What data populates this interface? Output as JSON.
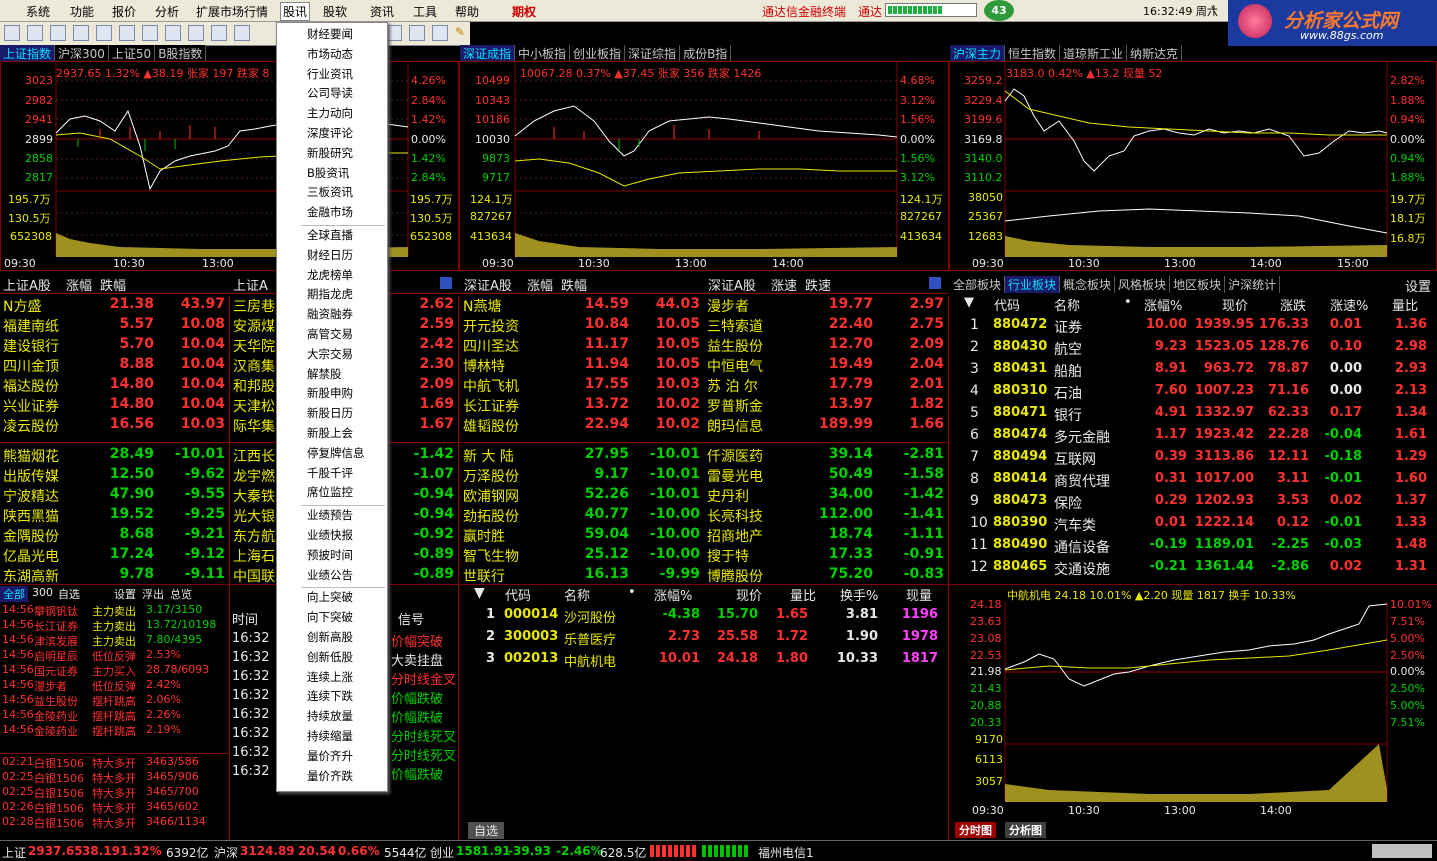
{
  "menu": {
    "items": [
      "系统",
      "功能",
      "报价",
      "分析",
      "扩展市场行情",
      "股讯",
      "股软",
      "资讯",
      "工具",
      "帮助",
      "期权"
    ],
    "promo1": "通达信金融终端",
    "promo2": "通达",
    "badge": "43",
    "clock": "16:32:49 周六",
    "logo": "分析家公式网",
    "logo_url": "www.88gs.com"
  },
  "dropdown": [
    "财经要闻",
    "市场动态",
    "行业资讯",
    "公司导读",
    "主力动向",
    "深度评论",
    "新股研究",
    "B股资讯",
    "三板资讯",
    "金融市场",
    "全球直播",
    "财经日历",
    "龙虎榜单",
    "期指龙虎",
    "融资融券",
    "高管交易",
    "大宗交易",
    "解禁股",
    "新股申购",
    "新股日历",
    "新股上会",
    "停复牌信息",
    "千股千评",
    "席位监控",
    "业绩预告",
    "业绩快报",
    "预披时间",
    "业绩公告",
    "向上突破",
    "向下突破",
    "创新高股",
    "创新低股",
    "连续上涨",
    "连续下跌",
    "持续放量",
    "持续缩量",
    "量价齐升",
    "量价齐跌"
  ],
  "chart1": {
    "tabs": [
      "上证指数",
      "沪深300",
      "上证50",
      "B股指数"
    ],
    "info": "2937.65 1.32% ▲38.19 张家 197 跌家 8",
    "ylabels": [
      "3023",
      "2982",
      "2941",
      "2899",
      "2858",
      "2817",
      "195.7万",
      "130.5万",
      "652308"
    ],
    "xlabels": [
      "09:30",
      "10:30",
      "13:00"
    ],
    "rlabels": [
      "4.26%",
      "2.84%",
      "1.42%",
      "0.00%",
      "1.42%",
      "2.84%",
      "195.7万",
      "130.5万",
      "652308"
    ]
  },
  "chart2": {
    "tabs": [
      "深证成指",
      "中小板指",
      "创业板指",
      "深证综指",
      "成份B指"
    ],
    "info": "10067.28 0.37% ▲37.45 张家 356 跌家 1426",
    "ylabels": [
      "10499",
      "10343",
      "10186",
      "10030",
      "9873",
      "9717",
      "124.1万",
      "827267",
      "413634"
    ],
    "rlabels": [
      "4.68%",
      "3.12%",
      "1.56%",
      "0.00%",
      "1.56%",
      "3.12%",
      "124.1万",
      "827267",
      "413634"
    ],
    "xlabels": [
      "09:30",
      "10:30",
      "13:00",
      "14:00"
    ]
  },
  "chart3": {
    "tabs": [
      "沪深主力",
      "恒生指数",
      "道琼斯工业",
      "纳斯达克"
    ],
    "info": "3183.0 0.42% ▲13.2 现量 52",
    "ylabels": [
      "3259.2",
      "3229.4",
      "3199.6",
      "3169.8",
      "3140.0",
      "3110.2",
      "38050",
      "25367",
      "12683"
    ],
    "rlabels": [
      "2.82%",
      "1.88%",
      "0.94%",
      "0.00%",
      "0.94%",
      "1.88%",
      "19.7万",
      "18.1万",
      "16.8万"
    ],
    "xlabels": [
      "09:30",
      "10:30",
      "13:00",
      "14:00",
      "15:00"
    ]
  },
  "sh_list": {
    "title": "上证A股",
    "cols": [
      "涨幅",
      "跌幅"
    ],
    "up": [
      [
        "N方盛",
        "21.38",
        "43.97"
      ],
      [
        "福建南纸",
        "5.57",
        "10.08"
      ],
      [
        "建设银行",
        "5.70",
        "10.04"
      ],
      [
        "四川金顶",
        "8.88",
        "10.04"
      ],
      [
        "福达股份",
        "14.80",
        "10.04"
      ],
      [
        "兴业证券",
        "14.80",
        "10.04"
      ],
      [
        "凌云股份",
        "16.56",
        "10.03"
      ]
    ],
    "down": [
      [
        "熊猫烟花",
        "28.49",
        "-10.01"
      ],
      [
        "出版传媒",
        "12.50",
        "-9.62"
      ],
      [
        "宁波精达",
        "47.90",
        "-9.55"
      ],
      [
        "陕西黑猫",
        "19.52",
        "-9.25"
      ],
      [
        "金隅股份",
        "8.68",
        "-9.21"
      ],
      [
        "亿晶光电",
        "17.24",
        "-9.12"
      ],
      [
        "东湖高新",
        "9.78",
        "-9.11"
      ]
    ]
  },
  "sh2_list": {
    "title": "上证A",
    "up": [
      [
        "三房巷",
        "2.62"
      ],
      [
        "安源煤",
        "2.59"
      ],
      [
        "天华院",
        "2.42"
      ],
      [
        "汉商集",
        "2.30"
      ],
      [
        "和邦股",
        "2.09"
      ],
      [
        "天津松",
        "1.69"
      ],
      [
        "际华集",
        "1.67"
      ]
    ],
    "down": [
      [
        "江西长",
        "-1.42"
      ],
      [
        "龙宇燃",
        "-1.07"
      ],
      [
        "大秦铁",
        "-0.94"
      ],
      [
        "光大银",
        "-0.94"
      ],
      [
        "东方航",
        "-0.92"
      ],
      [
        "上海石",
        "-0.89"
      ],
      [
        "中国联",
        "-0.89"
      ]
    ]
  },
  "sz_list": {
    "title": "深证A股",
    "cols": [
      "涨幅",
      "跌幅"
    ],
    "up": [
      [
        "N燕塘",
        "14.59",
        "44.03"
      ],
      [
        "开元投资",
        "10.84",
        "10.05"
      ],
      [
        "四川圣达",
        "11.17",
        "10.05"
      ],
      [
        "博林特",
        "11.94",
        "10.05"
      ],
      [
        "中航飞机",
        "17.55",
        "10.03"
      ],
      [
        "长江证券",
        "13.72",
        "10.02"
      ],
      [
        "雄韬股份",
        "22.94",
        "10.02"
      ]
    ],
    "down": [
      [
        "新 大 陆",
        "27.95",
        "-10.01"
      ],
      [
        "万泽股份",
        "9.17",
        "-10.01"
      ],
      [
        "欧浦钢网",
        "52.26",
        "-10.01"
      ],
      [
        "劲拓股份",
        "40.77",
        "-10.00"
      ],
      [
        "赢时胜",
        "59.04",
        "-10.00"
      ],
      [
        "智飞生物",
        "25.12",
        "-10.00"
      ],
      [
        "世联行",
        "16.13",
        "-9.99"
      ]
    ]
  },
  "sz2_list": {
    "title": "深证A股",
    "cols": [
      "涨速",
      "跌速"
    ],
    "up": [
      [
        "漫步者",
        "19.77",
        "2.97"
      ],
      [
        "三特索道",
        "22.40",
        "2.75"
      ],
      [
        "益生股份",
        "12.70",
        "2.09"
      ],
      [
        "中恒电气",
        "19.49",
        "2.04"
      ],
      [
        "苏 泊 尔",
        "17.79",
        "2.01"
      ],
      [
        "罗普斯金",
        "13.97",
        "1.82"
      ],
      [
        "朗玛信息",
        "189.99",
        "1.66"
      ]
    ],
    "down": [
      [
        "仟源医药",
        "39.14",
        "-2.81"
      ],
      [
        "雷曼光电",
        "50.49",
        "-1.58"
      ],
      [
        "史丹利",
        "34.00",
        "-1.42"
      ],
      [
        "长亮科技",
        "112.00",
        "-1.41"
      ],
      [
        "招商地产",
        "18.74",
        "-1.11"
      ],
      [
        "搜于特",
        "17.33",
        "-0.91"
      ],
      [
        "博腾股份",
        "75.20",
        "-0.83"
      ]
    ]
  },
  "sector": {
    "tabs": [
      "全部板块",
      "行业板块",
      "概念板块",
      "风格板块",
      "地区板块",
      "沪深统计"
    ],
    "settings": "设置",
    "cols": [
      "代码",
      "名称",
      "•",
      "涨幅%",
      "现价",
      "涨跌",
      "涨速%",
      "量比"
    ],
    "rows": [
      [
        "1",
        "880472",
        "证券",
        "10.00",
        "1939.95",
        "176.33",
        "0.01",
        "1.36"
      ],
      [
        "2",
        "880430",
        "航空",
        "9.23",
        "1523.05",
        "128.76",
        "0.10",
        "2.98"
      ],
      [
        "3",
        "880431",
        "船舶",
        "8.91",
        "963.72",
        "78.87",
        "0.00",
        "2.93"
      ],
      [
        "4",
        "880310",
        "石油",
        "7.60",
        "1007.23",
        "71.16",
        "0.00",
        "2.13"
      ],
      [
        "5",
        "880471",
        "银行",
        "4.91",
        "1332.97",
        "62.33",
        "0.17",
        "1.34"
      ],
      [
        "6",
        "880474",
        "多元金融",
        "1.17",
        "1923.42",
        "22.28",
        "-0.04",
        "1.61"
      ],
      [
        "7",
        "880494",
        "互联网",
        "0.39",
        "3113.86",
        "12.11",
        "-0.18",
        "1.29"
      ],
      [
        "8",
        "880414",
        "商贸代理",
        "0.31",
        "1017.00",
        "3.11",
        "-0.01",
        "1.60"
      ],
      [
        "9",
        "880473",
        "保险",
        "0.29",
        "1202.93",
        "3.53",
        "0.02",
        "1.37"
      ],
      [
        "10",
        "880390",
        "汽车类",
        "0.01",
        "1222.14",
        "0.12",
        "-0.01",
        "1.33"
      ],
      [
        "11",
        "880490",
        "通信设备",
        "-0.19",
        "1189.01",
        "-2.25",
        "-0.03",
        "1.48"
      ],
      [
        "12",
        "880465",
        "交通设施",
        "-0.21",
        "1361.44",
        "-2.86",
        "0.02",
        "1.31"
      ]
    ]
  },
  "watch": {
    "cols": [
      "代码",
      "名称",
      "•",
      "涨幅%",
      "现价",
      "量比",
      "换手%",
      "现量"
    ],
    "rows": [
      [
        "1",
        "000014",
        "沙河股份",
        "-4.38",
        "15.70",
        "1.65",
        "3.81",
        "1196"
      ],
      [
        "2",
        "300003",
        "乐普医疗",
        "2.73",
        "25.58",
        "1.72",
        "1.90",
        "1978"
      ],
      [
        "3",
        "002013",
        "中航机电",
        "10.01",
        "24.18",
        "1.80",
        "10.33",
        "1817"
      ]
    ],
    "tab": "自选"
  },
  "alerts": {
    "tabs": [
      "全部",
      "300",
      "自选"
    ],
    "right": [
      "设置",
      "浮出",
      "总览"
    ],
    "rows": [
      [
        "14:56",
        "攀钢钒钛",
        "主力卖出",
        "3.17/3150"
      ],
      [
        "14:56",
        "长江证券",
        "主力卖出",
        "13.72/10198"
      ],
      [
        "14:56",
        "津滨发展",
        "主力卖出",
        "7.80/4395"
      ],
      [
        "14:56",
        "启明星辰",
        "低位反弹",
        "2.53%"
      ],
      [
        "14:56",
        "国元证券",
        "主力买入",
        "28.78/6093"
      ],
      [
        "14:56",
        "漫步者",
        "低位反弹",
        "2.42%"
      ],
      [
        "14:56",
        "益生股份",
        "摆杆跳高",
        "2.06%"
      ],
      [
        "14:56",
        "金陵药业",
        "摆杆跳高",
        "2.26%"
      ],
      [
        "14:56",
        "金陵药业",
        "摆杆跳高",
        "2.19%"
      ]
    ],
    "futures": [
      [
        "02:21",
        "白银1506",
        "特大多开",
        "3463/586"
      ],
      [
        "02:25",
        "白银1506",
        "特大多开",
        "3465/906"
      ],
      [
        "02:25",
        "白银1506",
        "特大多开",
        "3465/700"
      ],
      [
        "02:26",
        "白银1506",
        "特大多开",
        "3465/602"
      ],
      [
        "02:28",
        "白银1506",
        "特大多开",
        "3466/1134"
      ]
    ]
  },
  "signals": {
    "h1": "时间",
    "h2": "信号",
    "times": [
      "16:32",
      "16:32",
      "16:32",
      "16:32",
      "16:32",
      "16:32",
      "16:32",
      "16:32"
    ],
    "sigs": [
      "价幅突破",
      "大卖挂盘",
      "分时线金叉",
      "价幅跌破",
      "价幅跌破",
      "分时线死叉",
      "分时线死叉",
      "价幅跌破"
    ]
  },
  "stock": {
    "info": "中航机电   24.18 10.01% ▲2.20 现量 1817 换手 10.33%",
    "ylabels": [
      "24.18",
      "23.63",
      "23.08",
      "22.53",
      "21.98",
      "21.43",
      "20.88",
      "20.33",
      "9170",
      "6113",
      "3057"
    ],
    "rlabels": [
      "10.01%",
      "7.51%",
      "5.00%",
      "2.50%",
      "0.00%",
      "2.50%",
      "5.00%",
      "7.51%"
    ],
    "xlabels": [
      "09:30",
      "10:30",
      "13:00",
      "14:00"
    ],
    "tabs": [
      "分时图",
      "分析图"
    ]
  },
  "status": {
    "sh_name": "上证",
    "sh": "2937.65",
    "sh_chg": "38.19",
    "sh_pct": "1.32%",
    "sh_amt": "6392亿",
    "sz_name": "沪深",
    "sz": "3124.89",
    "sz_chg": "20.54",
    "sz_pct": "0.66%",
    "sz_amt": "5544亿",
    "cy_name": "创业",
    "cy": "1581.91",
    "cy_chg": "-39.93",
    "cy_pct": "-2.46%",
    "cy_amt": "628.5亿",
    "server": "福州电信1"
  }
}
